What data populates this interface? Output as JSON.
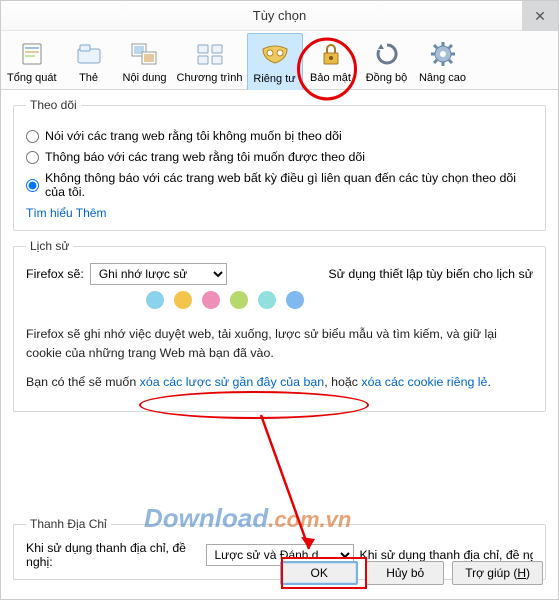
{
  "title": "Tùy chọn",
  "tabs": [
    {
      "key": "general",
      "label": "Tổng quát"
    },
    {
      "key": "tabs",
      "label": "Thẻ"
    },
    {
      "key": "content",
      "label": "Nội dung"
    },
    {
      "key": "apps",
      "label": "Chương trình"
    },
    {
      "key": "privacy",
      "label": "Riêng tư"
    },
    {
      "key": "security",
      "label": "Bảo mật"
    },
    {
      "key": "sync",
      "label": "Đồng bộ"
    },
    {
      "key": "advanced",
      "label": "Nâng cao"
    }
  ],
  "tracking": {
    "legend": "Theo dõi",
    "r1": "Nói với các trang web rằng tôi không muốn bị theo dõi",
    "r2": "Thông báo với các trang web rằng tôi muốn được theo dõi",
    "r3": "Không thông báo với các trang web bất kỳ điều gì liên quan đến các tùy chọn theo dõi của tôi.",
    "learn": "Tìm hiểu Thêm"
  },
  "history": {
    "legend": "Lịch sử",
    "prefix": "Firefox sẽ:",
    "selected": "Ghi nhớ lược sử",
    "tail": "Sử dụng thiết lập tùy biến cho lịch sử",
    "p1": "Firefox sẽ ghi nhớ việc duyệt web, tải xuống, lược sử biểu mẫu và tìm kiếm, và giữ lại cookie của những trang Web mà bạn đã vào.",
    "p2_pre": "Bạn có thể sẽ muốn ",
    "p2_link1": "xóa các lược sử gần đây của bạn",
    "p2_mid": ", hoặc ",
    "p2_link2": "xóa các cookie riêng lẻ",
    "p2_post": "."
  },
  "addressbar": {
    "legend": "Thanh Địa Chỉ",
    "before": "Khi sử dụng thanh địa chỉ, đề nghị:",
    "selected": "Lược sử và Đánh dấu",
    "after": "Khi sử dụng thanh địa chỉ, đề nghị:"
  },
  "buttons": {
    "ok": "OK",
    "cancel": "Hủy bỏ",
    "help_pre": "Trợ giúp (",
    "help_key": "H",
    "help_post": ")"
  },
  "watermark": {
    "a": "Download",
    "b": ".com.vn"
  },
  "dots": [
    "#8bd2ef",
    "#f3c54d",
    "#ef8fb8",
    "#b6d96d",
    "#90e0e0",
    "#7fb9ef"
  ]
}
